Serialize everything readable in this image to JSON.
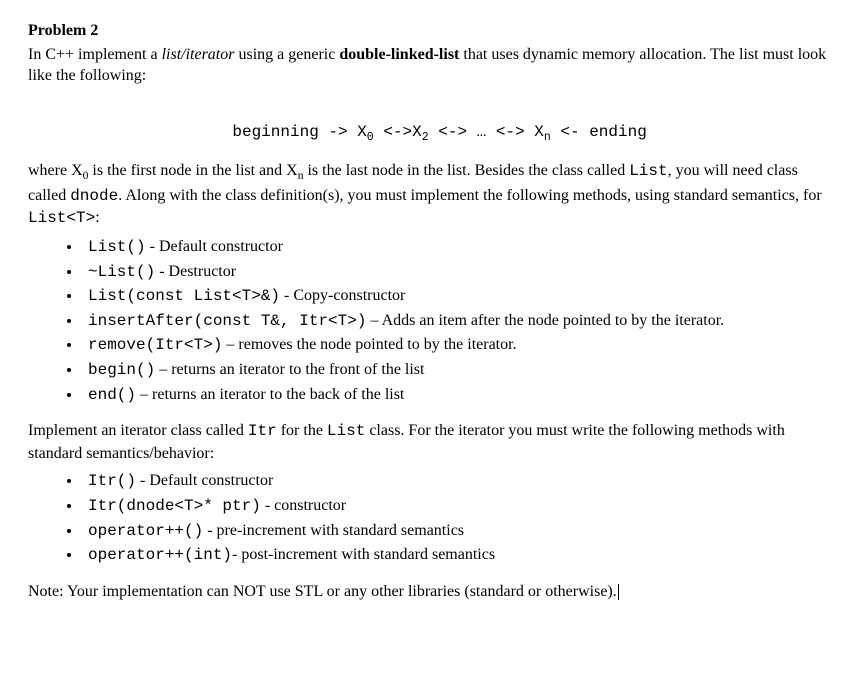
{
  "heading": "Problem 2",
  "intro_1": "In C++ implement a ",
  "intro_italic": "list/iterator",
  "intro_2": " using a generic ",
  "intro_bold": "double-linked-list",
  "intro_3": " that uses dynamic memory allocation.  The list must look like the following:",
  "diagram": {
    "begin": "beginning -> X",
    "sub0": "0",
    "midA": " <->X",
    "sub2": "2",
    "midB": " <-> … <-> X",
    "subn": "n",
    "end": " <- ending"
  },
  "where": {
    "p1": "where X",
    "s1": "0",
    "p2": " is the first node in the list and X",
    "s2": "n",
    "p3": " is the last node in the list.  Besides the class called ",
    "m1": "List",
    "p4": ", you will need class called ",
    "m2": "dnode",
    "p5": ".  Along with the class definition(s), you must implement the following methods, using standard semantics, for ",
    "m3": "List<T>",
    "p6": ":"
  },
  "list1": {
    "i1m": "List()",
    "i1t": " - Default constructor",
    "i2m": "~List()",
    "i2t": " - Destructor",
    "i3m": "List(const List<T>&)",
    "i3t": " - Copy-constructor",
    "i4m": "insertAfter(const T&, Itr<T>)",
    "i4t": " – Adds an item after the node pointed to by the iterator.",
    "i5m": "remove(Itr<T>)",
    "i5t": " – removes the node pointed to by the iterator.",
    "i6m": "begin()",
    "i6t": " – returns an iterator to the front of the list",
    "i7m": "end()",
    "i7t": " – returns an iterator to the back of the list"
  },
  "iterpara": {
    "p1": "Implement an iterator class called ",
    "m1": "Itr",
    "p2": " for the ",
    "m2": "List",
    "p3": " class.  For the iterator you must write the following methods with standard semantics/behavior:"
  },
  "list2": {
    "i1m": "Itr()",
    "i1t": " - Default constructor",
    "i2m": "Itr(dnode<T>* ptr)",
    "i2t": " - constructor",
    "i3m": "operator++()",
    "i3t": " - pre-increment with standard semantics",
    "i4m": "operator++(int)",
    "i4t": "- post-increment with standard semantics"
  },
  "note": "Note: Your implementation can NOT use STL or any other libraries (standard or otherwise)."
}
